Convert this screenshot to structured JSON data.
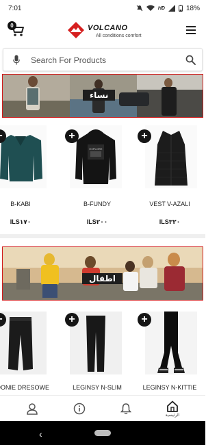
{
  "status": {
    "time": "7:01",
    "battery": "18%",
    "network": "HD"
  },
  "header": {
    "cart_count": "0",
    "brand_name": "VOLCANO",
    "brand_tagline": "All conditions comfort"
  },
  "search": {
    "placeholder": "Search For Products"
  },
  "sections": [
    {
      "label": "نساء",
      "products": [
        {
          "name": "B-KABI",
          "price": "ILS١٧٠"
        },
        {
          "name": "B-FUNDY",
          "price": "ILS٢٠٠"
        },
        {
          "name": "VEST V-AZALI",
          "price": "ILS٣٢٠"
        }
      ]
    },
    {
      "label": "اطفال",
      "products": [
        {
          "name": "POONIE DRESOWE"
        },
        {
          "name": "LEGINSY N-SLIM"
        },
        {
          "name": "LEGINSY N-KITTIE"
        }
      ]
    }
  ],
  "add_label": "+",
  "bottom_nav": {
    "home_label": "الرئيسية"
  },
  "colors": {
    "accent": "#d01a1a",
    "label_bg": "#1e1e1e"
  }
}
